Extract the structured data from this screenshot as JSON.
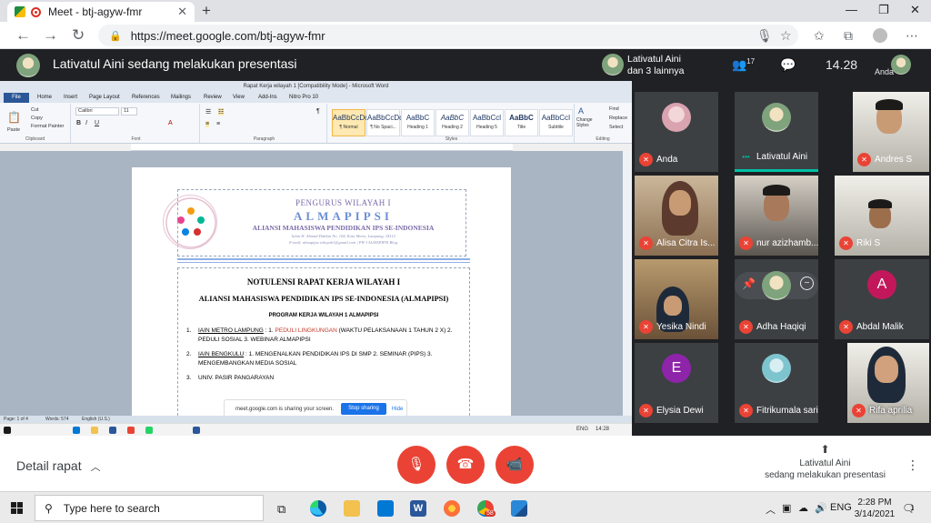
{
  "browser": {
    "tab_title": "Meet - btj-agyw-fmr",
    "tab_close": "✕",
    "new_tab": "+",
    "url": "https://meet.google.com/btj-agyw-fmr",
    "window": {
      "minimize": "—",
      "restore": "❐",
      "close": "✕"
    }
  },
  "meet_top": {
    "presenting_text": "Lativatul Aini sedang melakukan presentasi",
    "presenter_name": "Lativatul Aini",
    "presenter_others": "dan 3 lainnya",
    "participant_count": "17",
    "clock": "14.28",
    "self_label": "Anda"
  },
  "word": {
    "title": "Rapat Kerja wilayah 1 [Compatibility Mode] - Microsoft Word",
    "file_tab": "File",
    "tabs": [
      "Home",
      "Insert",
      "Page Layout",
      "References",
      "Mailings",
      "Review",
      "View",
      "Add-Ins",
      "Nitro Pro 10"
    ],
    "clipboard": {
      "paste": "Paste",
      "cut": "Cut",
      "copy": "Copy",
      "format_painter": "Format Painter",
      "label": "Clipboard"
    },
    "font": {
      "name": "Calibri",
      "size": "11",
      "label": "Font"
    },
    "paragraph_label": "Paragraph",
    "styles_label": "Styles",
    "editing_label": "Editing",
    "change_styles": "Change Styles",
    "find": "Find",
    "replace": "Replace",
    "select": "Select",
    "styles": [
      {
        "sample": "AaBbCcDc",
        "name": "¶ Normal"
      },
      {
        "sample": "AaBbCcDc",
        "name": "¶ No Spaci..."
      },
      {
        "sample": "AaBbC",
        "name": "Heading 1"
      },
      {
        "sample": "AaBbC",
        "name": "Heading 2"
      },
      {
        "sample": "AaBbCcl",
        "name": "Heading 5"
      },
      {
        "sample": "AaBbC",
        "name": "Title"
      },
      {
        "sample": "AaBbCcI",
        "name": "Subtitle"
      }
    ],
    "doc": {
      "org_line1": "PENGURUS WILAYAH I",
      "org_line2": "ALMAPIPSI",
      "org_line3": "ALIANSI MAHASISWA PENDIDIKAN IPS SE-INDONESIA",
      "address": "Jalan H. Ahmad Dahlan No. 104, Kota Metro, Lampung, 34112",
      "contact": "E-mail: almapipsi.wilayah1@gmail.com | PW I ALMAPIPSI Blog",
      "heading1": "NOTULENSI RAPAT KERJA WILAYAH I",
      "heading2": "ALIANSI MAHASISWA PENDIDIKAN IPS SE-INDONESIA (ALMAPIPSI)",
      "heading3": "PROGRAM KERJA WILAYAH 1 ALMAPIPSI",
      "items": [
        {
          "num": "1.",
          "campus": "IAIN METRO LAMPUNG",
          "text_a": " : 1. ",
          "red": "PEDULI LINGKUNGAN",
          "text_b": " (WAKTU PELAKSANAAN 1 TAHUN 2 X) 2.",
          "line2": "PEDULI SOSIAL 3. WEBINAR ALMAPIPSI"
        },
        {
          "num": "2.",
          "campus": "IAIN BENGKULU",
          "text_a": " : 1. MENGENALKAN PENDIDIKAN IPS DI SMP 2. SEMINAR (PIPS) 3.",
          "red": "",
          "text_b": "",
          "line2": "MENGEMBANGKAN MEDIA SOSIAL"
        },
        {
          "num": "3.",
          "campus": "UNIV. PASIR PANGARAYAN",
          "text_a": "",
          "red": "",
          "text_b": "",
          "line2": ""
        }
      ]
    },
    "share": {
      "text": "meet.google.com is sharing your screen.",
      "stop": "Stop sharing",
      "hide": "Hide"
    },
    "status": {
      "page": "Page: 1 of 4",
      "words": "Words: 574",
      "lang": "English (U.S.)"
    },
    "taskbar": {
      "lang": "ENG",
      "time": "14:28"
    }
  },
  "participants": [
    {
      "name": "Anda",
      "kind": "avatar"
    },
    {
      "name": "Lativatul Aini",
      "kind": "avatar"
    },
    {
      "name": "Andres S",
      "kind": "video"
    },
    {
      "name": "Alisa Citra Is...",
      "kind": "video"
    },
    {
      "name": "nur azizhamb...",
      "kind": "video"
    },
    {
      "name": "Riki S",
      "kind": "video"
    },
    {
      "name": "Yesika Nindi",
      "kind": "video"
    },
    {
      "name": "Adha Haqiqi",
      "kind": "avatar"
    },
    {
      "name": "Abdal Malik",
      "kind": "letter",
      "letter": "A",
      "color": "#c2185b"
    },
    {
      "name": "Elysia Dewi",
      "kind": "letter",
      "letter": "E",
      "color": "#8e24aa"
    },
    {
      "name": "Fitrikumala sari",
      "kind": "avatar"
    },
    {
      "name": "Rifa aprilia",
      "kind": "video"
    }
  ],
  "controls": {
    "detail": "Detail rapat",
    "present_name": "Lativatul Aini",
    "present_status": "sedang melakukan presentasi"
  },
  "taskbar": {
    "search_placeholder": "Type here to search",
    "badge": "58",
    "lang": "ENG",
    "time": "2:28 PM",
    "date": "3/14/2021",
    "notif": "1"
  },
  "colors": {
    "meet_red": "#ea4335",
    "meet_dark": "#202124",
    "share_blue": "#1a73e8"
  }
}
